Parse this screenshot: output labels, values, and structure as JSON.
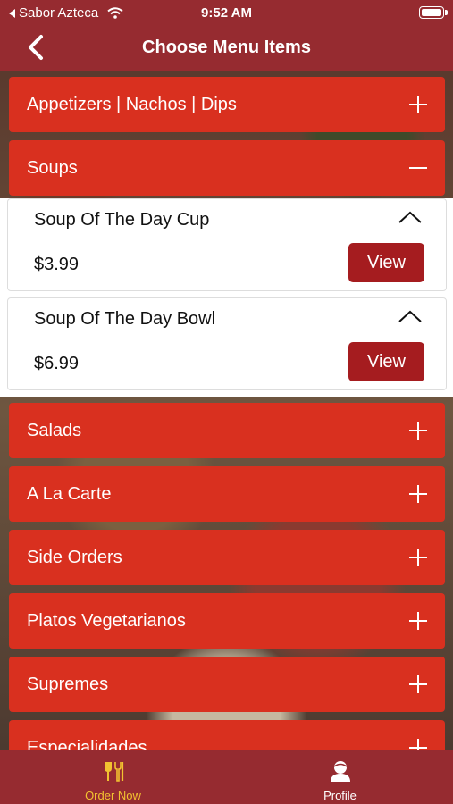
{
  "status": {
    "carrier": "Sabor Azteca",
    "time": "9:52 AM"
  },
  "nav": {
    "title": "Choose Menu Items",
    "back_icon": "chevron-left-icon"
  },
  "categories_top": [
    {
      "label": "Appetizers | Nachos | Dips",
      "expanded": false
    },
    {
      "label": "Soups",
      "expanded": true
    }
  ],
  "soups": {
    "items": [
      {
        "name": "Soup Of The Day Cup",
        "price": "$3.99",
        "button": "View"
      },
      {
        "name": "Soup Of The Day Bowl",
        "price": "$6.99",
        "button": "View"
      }
    ]
  },
  "categories_bottom": [
    {
      "label": "Salads"
    },
    {
      "label": "A La Carte"
    },
    {
      "label": "Side Orders"
    },
    {
      "label": "Platos Vegetarianos"
    },
    {
      "label": "Supremes"
    },
    {
      "label": "Especialidades"
    }
  ],
  "tabs": [
    {
      "label": "Order Now",
      "icon": "utensils-icon",
      "active": true,
      "color": "#f2c230"
    },
    {
      "label": "Profile",
      "icon": "user-icon",
      "active": false,
      "color": "#ffffff"
    }
  ]
}
